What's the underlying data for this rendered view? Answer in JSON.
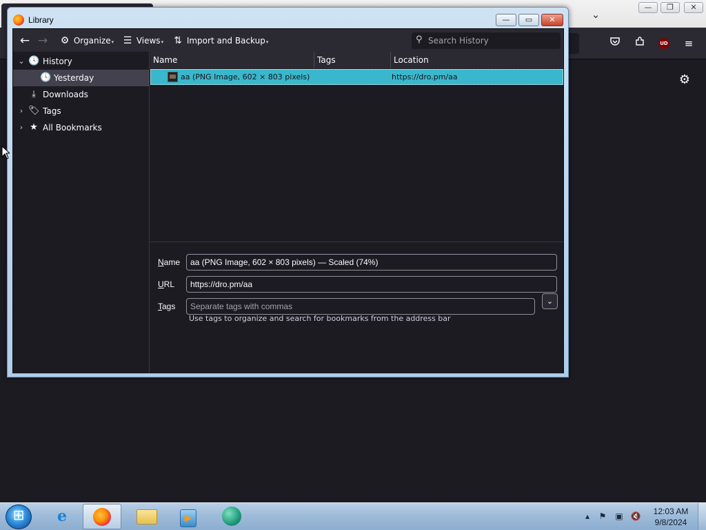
{
  "background_window": {
    "chevron_icon": "chevron-down-icon",
    "window_buttons": {
      "minimize": "—",
      "restore": "❐",
      "close": "✕"
    },
    "toolbar_icons": [
      "pocket-icon",
      "extensions-icon",
      "ublock-icon",
      "menu-icon"
    ],
    "ublock_label": "UD",
    "settings_icon": "gear-icon"
  },
  "library": {
    "title": "Library",
    "window_buttons": {
      "minimize": "—",
      "maximize": "▭",
      "close": "✕"
    },
    "toolbar": {
      "back_icon": "←",
      "forward_icon": "→",
      "organize": "Organize",
      "views": "Views",
      "import_backup": "Import and Backup",
      "search_placeholder": "Search History"
    },
    "tree": [
      {
        "label": "History",
        "twisty": "⌄",
        "icon": "clock-icon"
      },
      {
        "label": "Yesterday",
        "icon": "clock-icon"
      },
      {
        "label": "Downloads",
        "icon": "download-icon"
      },
      {
        "label": "Tags",
        "twisty": "›",
        "icon": "tag-icon"
      },
      {
        "label": "All Bookmarks",
        "twisty": "›",
        "icon": "star-icon"
      }
    ],
    "columns": [
      "Name",
      "Tags",
      "Location"
    ],
    "rows": [
      {
        "name": "aa (PNG Image, 602 × 803 pixels) ...",
        "tags": "",
        "location": "https://dro.pm/aa"
      }
    ],
    "details": {
      "name_label_key": "N",
      "name_label_rest": "ame",
      "name_value": "aa (PNG Image, 602 × 803 pixels) — Scaled (74%)",
      "url_label_key": "U",
      "url_label_rest": "RL",
      "url_value": "https://dro.pm/aa",
      "tags_label_key": "T",
      "tags_label_rest": "ags",
      "tags_placeholder": "Separate tags with commas",
      "tags_hint": "Use tags to organize and search for bookmarks from the address bar"
    }
  },
  "taskbar": {
    "apps": [
      "internet-explorer",
      "firefox",
      "file-explorer",
      "media-player",
      "green-app"
    ],
    "clock_time": "12:03 AM",
    "clock_date": "9/8/2024"
  }
}
